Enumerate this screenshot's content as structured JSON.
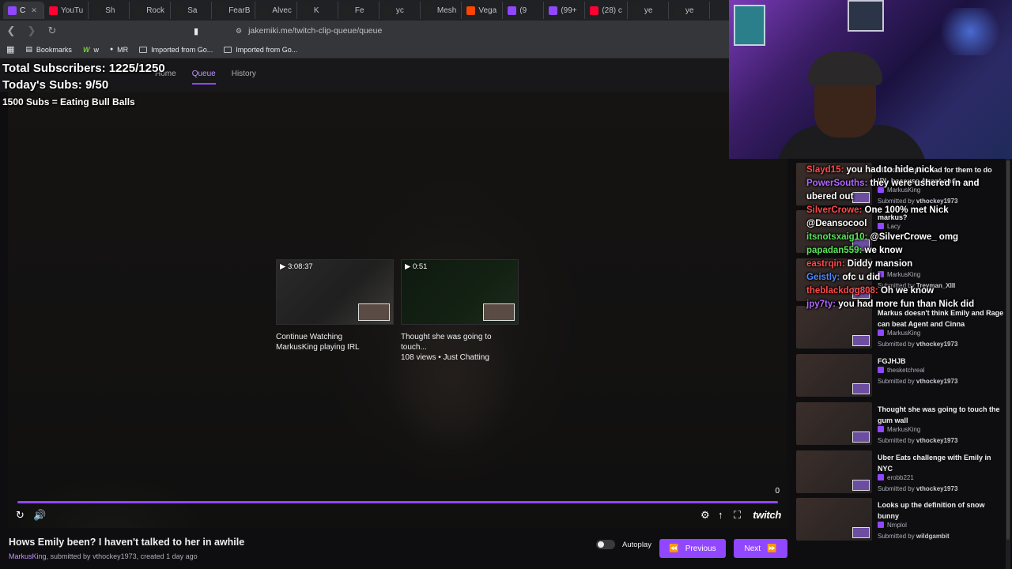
{
  "browser": {
    "tabs": [
      {
        "label": "C",
        "color": "#9147ff",
        "active": true
      },
      {
        "label": "YouTu",
        "color": "#ff0033"
      },
      {
        "label": "Sh",
        "color": "#222"
      },
      {
        "label": "Rock",
        "color": "#222"
      },
      {
        "label": "Sa",
        "color": "#222"
      },
      {
        "label": "FearB",
        "color": "#222"
      },
      {
        "label": "Alvec",
        "color": "#222"
      },
      {
        "label": "K",
        "color": "#222"
      },
      {
        "label": "Fe",
        "color": "#222"
      },
      {
        "label": "yc",
        "color": "#222"
      },
      {
        "label": "Mesh",
        "color": "#222"
      },
      {
        "label": "Vega",
        "color": "#ff4500"
      },
      {
        "label": "(9",
        "color": "#9147ff"
      },
      {
        "label": "(99+",
        "color": "#9147ff"
      },
      {
        "label": "(28) c",
        "color": "#ff0033"
      },
      {
        "label": "ye",
        "color": "#222"
      },
      {
        "label": "ye",
        "color": "#222"
      }
    ],
    "url": "jakemiki.me/twitch-clip-queue/queue",
    "bookmarks": [
      {
        "label": "Bookmarks",
        "icon": "bookmarks-icon"
      },
      {
        "label": "w",
        "icon": "w-icon"
      },
      {
        "label": "MR",
        "icon": "mr-icon"
      },
      {
        "label": "Imported from Go...",
        "icon": "folder-icon"
      },
      {
        "label": "Imported from Go...",
        "icon": "folder-icon"
      }
    ]
  },
  "app": {
    "nav": [
      "Home",
      "Queue",
      "History"
    ],
    "active_nav": "Queue"
  },
  "overlay": {
    "total_subs": "Total Subscribers: 1225/1250",
    "todays_subs": "Today's Subs: 9/50",
    "goal": "1500 Subs = Eating Bull Balls"
  },
  "player": {
    "counter": "0",
    "progress": 1.0,
    "end_cards": [
      {
        "duration": "3:08:37",
        "line1": "Continue Watching",
        "line2": "MarkusKing playing IRL"
      },
      {
        "duration": "0:51",
        "line1": "Thought she was going to touch...",
        "line2": "108 views • Just Chatting"
      }
    ],
    "brand": "twitch"
  },
  "clip": {
    "title": "Hows Emily been? I haven't talked to her in awhile",
    "channel": "MarkusKing",
    "meta_rest": ", submitted by ",
    "submitter": "vthockey1973",
    "age": ", created 1 day ago",
    "autoplay_label": "Autoplay",
    "prev_label": "Previous",
    "next_label": "Next"
  },
  "queue": [
    {
      "title": "Markus' super mad for them to do IRL because Agent and...",
      "channel": "MarkusKing",
      "submitted": "Submitted by ",
      "submitter": "vthockey1973"
    },
    {
      "title": "markus?",
      "channel": "Lacy",
      "submitted": "",
      "submitter": ""
    },
    {
      "title": "",
      "channel": "MarkusKing",
      "submitted": "Submitted by ",
      "submitter": "Treyman_XIII"
    },
    {
      "title": "Markus doesn't think Emily and Rage can beat Agent and Cinna",
      "channel": "MarkusKing",
      "submitted": "Submitted by ",
      "submitter": "vthockey1973"
    },
    {
      "title": "FGJHJB",
      "channel": "thesketchreal",
      "submitted": "Submitted by ",
      "submitter": "vthockey1973"
    },
    {
      "title": "Thought she was going to touch the gum wall",
      "channel": "MarkusKing",
      "submitted": "Submitted by ",
      "submitter": "vthockey1973"
    },
    {
      "title": "Uber Eats challenge with Emily in NYC",
      "channel": "erobb221",
      "submitted": "Submitted by ",
      "submitter": "vthockey1973"
    },
    {
      "title": "Looks up the definition of snow bunny",
      "channel": "Nmplol",
      "submitted": "Submitted by ",
      "submitter": "wildgambit"
    }
  ],
  "chat": [
    {
      "user": "Slayd15:",
      "msg": " you had to hide nick",
      "color": "r"
    },
    {
      "user": "PowerSouths:",
      "msg": " they were ushered in and ubered out",
      "color": "p"
    },
    {
      "user": "SilverCrowe:",
      "msg": " One 100% met Nick",
      "color": "r"
    },
    {
      "user": "",
      "msg": "@Deansocool",
      "color": "r"
    },
    {
      "user": "itsnotsxaig10:",
      "msg": " @SilverCrowe_ omg",
      "color": "g"
    },
    {
      "user": "papadan559:",
      "msg": " we know",
      "color": "g"
    },
    {
      "user": "eastrqin:",
      "msg": " Diddy mansion",
      "color": "r"
    },
    {
      "user": "Geistly:",
      "msg": " ofc u did",
      "color": "b"
    },
    {
      "user": "theblackdog808:",
      "msg": " Oh we know",
      "color": "r"
    },
    {
      "user": "jpy7ty:",
      "msg": " you had more fun than Nick did",
      "color": "p"
    }
  ],
  "colors": {
    "accent": "#9147ff",
    "bg": "#0e0e10"
  }
}
